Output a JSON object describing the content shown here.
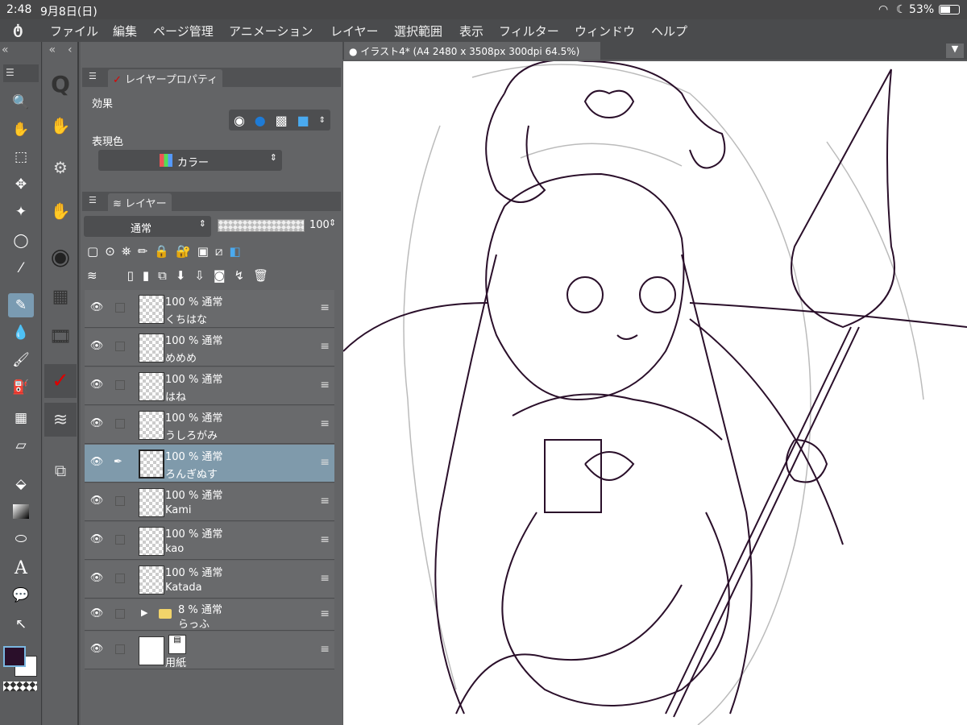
{
  "status": {
    "time": "2:48",
    "date": "9月8日(日)",
    "battery": "53%"
  },
  "menu": [
    "ファイル",
    "編集",
    "ページ管理",
    "アニメーション",
    "レイヤー",
    "選択範囲",
    "表示",
    "フィルター",
    "ウィンドウ",
    "ヘルプ"
  ],
  "doc_tab": "イラスト4* (A4 2480 x 3508px 300dpi 64.5%)",
  "props": {
    "title": "レイヤープロパティ",
    "effect_label": "効果",
    "color_label": "表現色",
    "color_value": "カラー"
  },
  "layers_panel": {
    "title": "レイヤー",
    "blend": "通常",
    "opacity": "100"
  },
  "layers": [
    {
      "info": "100 % 通常",
      "name": "くちはな"
    },
    {
      "info": "100 % 通常",
      "name": "めめめ"
    },
    {
      "info": "100 % 通常",
      "name": "はね"
    },
    {
      "info": "100 % 通常",
      "name": "うしろがみ"
    },
    {
      "info": "100 % 通常",
      "name": "ろんぎぬす"
    },
    {
      "info": "100 % 通常",
      "name": "Kami"
    },
    {
      "info": "100 % 通常",
      "name": "kao"
    },
    {
      "info": "100 % 通常",
      "name": "Katada"
    },
    {
      "info": "8 % 通常",
      "name": "らっふ"
    },
    {
      "info": "",
      "name": "用紙"
    }
  ],
  "colors": {
    "main": "#2a0f2a",
    "sub": "#ffffff",
    "selected_row": "#7f9aab",
    "accent": "#1e7bd6"
  }
}
